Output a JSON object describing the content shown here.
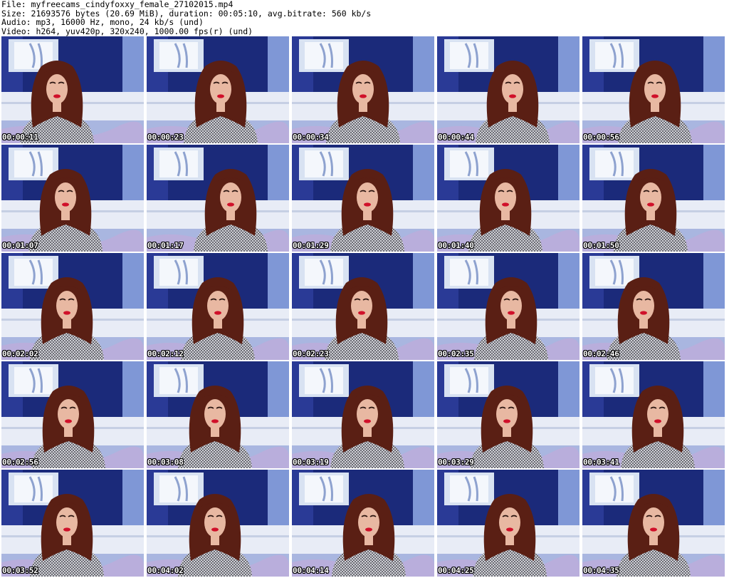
{
  "header": {
    "file_line": "File: myfreecams_cindyfoxxy_female_27102015.mp4",
    "size_line": "Size: 21693576 bytes (20.69 MiB), duration: 00:05:10, avg.bitrate: 560 kb/s",
    "audio_line": "Audio: mp3, 16000 Hz, mono, 24 kb/s (und)",
    "video_line": "Video: h264, yuv420p, 320x240, 1000.00 fps(r) (und)"
  },
  "frames": [
    {
      "time": "00:00:11"
    },
    {
      "time": "00:00:23"
    },
    {
      "time": "00:00:34"
    },
    {
      "time": "00:00:44"
    },
    {
      "time": "00:00:56"
    },
    {
      "time": "00:01:07"
    },
    {
      "time": "00:01:17"
    },
    {
      "time": "00:01:29"
    },
    {
      "time": "00:01:40"
    },
    {
      "time": "00:01:50"
    },
    {
      "time": "00:02:02"
    },
    {
      "time": "00:02:12"
    },
    {
      "time": "00:02:23"
    },
    {
      "time": "00:02:35"
    },
    {
      "time": "00:02:46"
    },
    {
      "time": "00:02:56"
    },
    {
      "time": "00:03:08"
    },
    {
      "time": "00:03:19"
    },
    {
      "time": "00:03:29"
    },
    {
      "time": "00:03:41"
    },
    {
      "time": "00:03:52"
    },
    {
      "time": "00:04:02"
    },
    {
      "time": "00:04:14"
    },
    {
      "time": "00:04:25"
    },
    {
      "time": "00:04:35"
    }
  ],
  "colors": {
    "wall": "#1b2a7a",
    "panel": "#d8e2f2",
    "sofa": "#e8ecf6",
    "hair": "#5a1f14",
    "skin": "#e8b8a2",
    "top": "#cfd0d6",
    "lips": "#d0102a"
  }
}
